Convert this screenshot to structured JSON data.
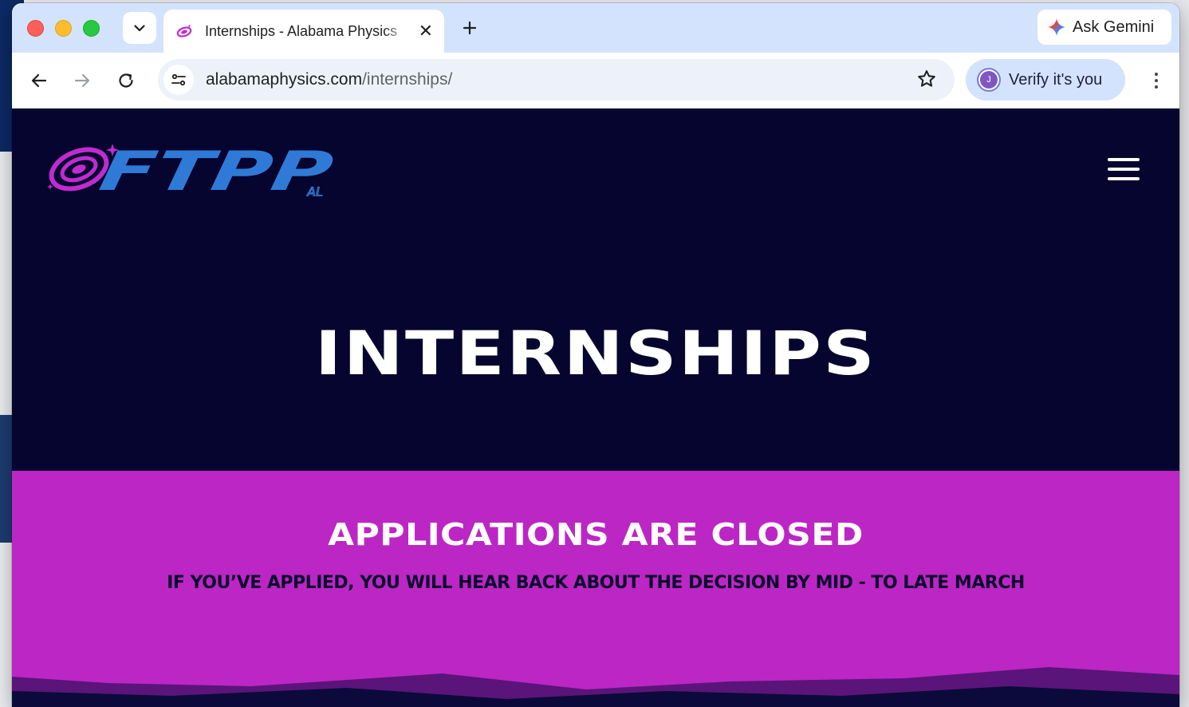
{
  "browser": {
    "tab_title": "Internships - Alabama Physics",
    "new_tab_symbol": "+",
    "ask_gemini_label": "Ask Gemini",
    "url_domain": "alabamaphysics.com",
    "url_path": "/internships/",
    "verify_label": "Verify it's you",
    "profile_initial": "J"
  },
  "site": {
    "logo_text": "FTPP",
    "logo_sub": "AL",
    "hero_title": "INTERNSHIPS",
    "closed_title": "APPLICATIONS ARE CLOSED",
    "closed_subtitle": "IF YOU’VE APPLIED, YOU WILL HEAR BACK ABOUT THE DECISION BY MID - TO LATE MARCH"
  },
  "colors": {
    "page_bg": "#05052f",
    "band_bg": "#bc26c4",
    "logo_blue": "#2f7ad6",
    "logo_magenta": "#c02bd0",
    "tab_strip": "#d3e3fd"
  },
  "icons": [
    "chevron-down-icon",
    "close-icon",
    "plus-icon",
    "gemini-spark-icon",
    "back-arrow-icon",
    "forward-arrow-icon",
    "reload-icon",
    "site-info-icon",
    "star-icon",
    "kebab-menu-icon",
    "hamburger-menu-icon"
  ]
}
